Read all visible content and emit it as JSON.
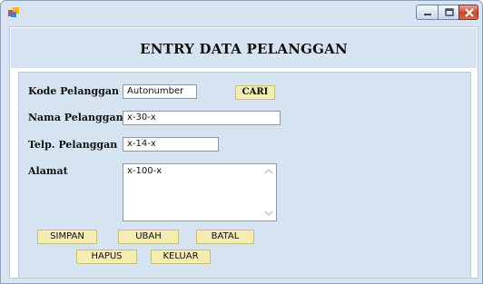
{
  "window": {
    "icon": "app-icon",
    "controls": {
      "minimize_icon": "minimize-icon",
      "maximize_icon": "maximize-icon",
      "close_icon": "close-icon"
    }
  },
  "form": {
    "title": "ENTRY DATA PELANGGAN",
    "fields": {
      "kode": {
        "label": "Kode Pelanggan",
        "value": "Autonumber"
      },
      "nama": {
        "label": "Nama Pelanggan",
        "value": "x-30-x"
      },
      "telp": {
        "label": "Telp. Pelanggan",
        "value": "x-14-x"
      },
      "alamat": {
        "label": "Alamat",
        "value": "x-100-x"
      }
    },
    "buttons": {
      "cari": "CARI",
      "simpan": "SIMPAN",
      "ubah": "UBAH",
      "batal": "BATAL",
      "hapus": "HAPUS",
      "keluar": "KELUAR"
    }
  },
  "colors": {
    "window_frame": "#d8e4f1",
    "panel": "#d6e3f1",
    "button": "#f4ecb0",
    "close_button": "#c6452d"
  }
}
